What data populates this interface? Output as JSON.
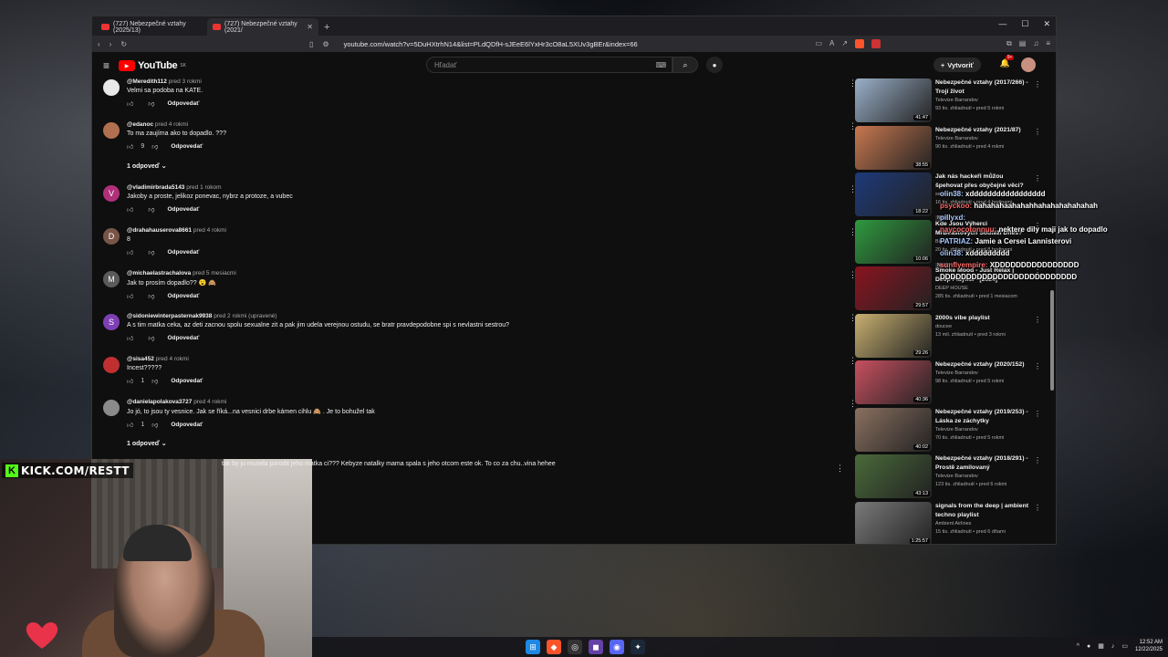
{
  "browser": {
    "tabs": [
      {
        "label": "(727) Nebezpečné vztahy (2025/13)"
      },
      {
        "label": "(727) Nebezpečné vztahy (2021/"
      }
    ],
    "url": "youtube.com/watch?v=5DuHXtrhN14&list=PLdQDfH-sJEeE6lYxHr3cO8aL5XUv3gBEr&index=66"
  },
  "youtube": {
    "logo_text": "YouTube",
    "logo_region": "SK",
    "search_placeholder": "Hľadať",
    "create_label": "Vytvoriť",
    "notif_badge": "9+"
  },
  "comments": [
    {
      "user": "@Meredith112",
      "time": "pred 3 rokmi",
      "text": "Velmi sa podoba na KATE.",
      "likes": "",
      "avatar_letter": "",
      "avatar_color": "#e8e8e8",
      "reply": "Odpovedať",
      "replies": ""
    },
    {
      "user": "@edanoc",
      "time": "pred 4 rokmi",
      "text": "To ma zaujíma ako to dopadlo. ???",
      "likes": "9",
      "avatar_letter": "",
      "avatar_color": "#b07050",
      "reply": "Odpovedať",
      "replies": "1 odpoveď"
    },
    {
      "user": "@vladimirbrada5143",
      "time": "pred 1 rokom",
      "text": "Jakoby a proste, jelikoz ponevac, nybrz a protoze, a vubec",
      "likes": "",
      "avatar_letter": "V",
      "avatar_color": "#b0307a",
      "reply": "Odpovedať",
      "replies": ""
    },
    {
      "user": "@drahahauserova8661",
      "time": "pred 4 rokmi",
      "text": "8",
      "likes": "",
      "avatar_letter": "D",
      "avatar_color": "#795548",
      "reply": "Odpovedať",
      "replies": ""
    },
    {
      "user": "@michaelastrachalova",
      "time": "pred 5 mesiacmi",
      "text": "Jak to prosím dopadlo?? 😮 🙈",
      "likes": "",
      "avatar_letter": "M",
      "avatar_color": "#5a5a5a",
      "reply": "Odpovedať",
      "replies": ""
    },
    {
      "user": "@sidoniewinterpasternak9938",
      "time": "pred 2 rokmi (upravené)",
      "text": "A s tim matka ceka, az deti zacnou spolu sexualne zit a pak jim udela verejnou ostudu, se bratr pravdepodobne spi s nevlastni sestrou?",
      "likes": "",
      "avatar_letter": "S",
      "avatar_color": "#7e3fb5",
      "reply": "Odpovedať",
      "replies": ""
    },
    {
      "user": "@sisa452",
      "time": "pred 4 rokmi",
      "text": "Incest?????",
      "likes": "1",
      "avatar_letter": "",
      "avatar_color": "#c03030",
      "reply": "Odpovedať",
      "replies": ""
    },
    {
      "user": "@danielapolakova3727",
      "time": "pred 4 rokmi",
      "text": "Jo jó, to jsou ty vesnice. Jak se říká...na vesnici drbe kámen cihlu 🙈 . Je to bohužel tak",
      "likes": "1",
      "avatar_letter": "",
      "avatar_color": "#8a8a8a",
      "reply": "Odpovedať",
      "replies": "1 odpoveď"
    }
  ],
  "partial_comment": "tak by ju musela porodit jeho matka ci??? Kebyze natalky mama spala s jeho otcom este ok. To co za chu..vina hehee",
  "sidebar": [
    {
      "title": "Nebezpečné vztahy (2017/266) - Trojí život",
      "channel": "Televize Barrandov",
      "stats": "93 tis. zhliadnutí • pred 5 rokmi",
      "duration": "41:47",
      "color": "#9ab0c8",
      "new": ""
    },
    {
      "title": "Nebezpečné vztahy (2021/87)",
      "channel": "Televize Barrandov",
      "stats": "90 tis. zhliadnutí • pred 4 rokmi",
      "duration": "38:55",
      "color": "#c87850",
      "new": ""
    },
    {
      "title": "Jak nás hackeři můžou špehovat přes obyčejné věci?",
      "channel": "segment",
      "stats": "16 tis. zhliadnutí • pred 4 hodinami",
      "duration": "18:22",
      "color": "#1e3a7a",
      "new": "Nové"
    },
    {
      "title": "Kde Jsou Výherci MrBeastových Soutěží Dnes?",
      "channel": "Bige",
      "stats": "20 tis. zhliadnutí • pred 8 hodinami",
      "duration": "10:06",
      "color": "#2e9a3e",
      "new": "Nové"
    },
    {
      "title": "Smoke Mood - Just Relax | Deep Playlist - [2024]",
      "channel": "DEEP HOUSE",
      "stats": "285 tis. zhliadnutí • pred 1 mesiacom",
      "duration": "29:57",
      "color": "#8a1420",
      "new": ""
    },
    {
      "title": "2000s vibe playlist",
      "channel": "doucee",
      "stats": "13 mil. zhliadnutí • pred 3 rokmi",
      "duration": "29:26",
      "color": "#c8b070",
      "new": ""
    },
    {
      "title": "Nebezpečné vztahy (2020/152)",
      "channel": "Televize Barrandov",
      "stats": "98 tis. zhliadnutí • pred 5 rokmi",
      "duration": "40:36",
      "color": "#c85060",
      "new": ""
    },
    {
      "title": "Nebezpečné vztahy (2019/253) - Láska ze záchytky",
      "channel": "Televize Barrandov",
      "stats": "70 tis. zhliadnutí • pred 5 rokmi",
      "duration": "40:02",
      "color": "#8a7060",
      "new": ""
    },
    {
      "title": "Nebezpečné vztahy (2018/291) - Prostě zamilovaný",
      "channel": "Televize Barrandov",
      "stats": "123 tis. zhliadnutí • pred 6 rokmi",
      "duration": "43:13",
      "color": "#4a6a3a",
      "new": ""
    },
    {
      "title": "signals from the deep | ambient techno playlist",
      "channel": "Ambient Airlines",
      "stats": "15 tis. zhliadnutí • pred 6 dňami",
      "duration": "1:25:57",
      "color": "#7a7a7a",
      "new": ""
    }
  ],
  "chat": [
    {
      "user": "olin38:",
      "msg": "xddddddddddddddddd",
      "cls": ""
    },
    {
      "user": "psyckoo:",
      "msg": "hahahahaahahahhahahahahahahah",
      "cls": "red"
    },
    {
      "user": "pillyxd:",
      "msg": "",
      "cls": ""
    },
    {
      "user": "naycocotonnuu:",
      "msg": "nektere dily maji jak to dopadlo",
      "cls": "red"
    },
    {
      "user": "PATRIAZ:",
      "msg": "Jamie a Cersei Lannisterovi",
      "cls": ""
    },
    {
      "user": "olin38:",
      "msg": "xddddddddd",
      "cls": ""
    },
    {
      "user": "sunflyempire:",
      "msg": "XDDDDDDDDDDDDDDDD",
      "cls": "red"
    },
    {
      "user": "",
      "msg": "DDDDDDDDDDDDDDDDDDDDDDDDDD",
      "cls": ""
    }
  ],
  "stream": {
    "kick_url": "KICK.COM/RESTT"
  },
  "taskbar": {
    "time": "12:52 AM",
    "date": "12/22/2025"
  }
}
